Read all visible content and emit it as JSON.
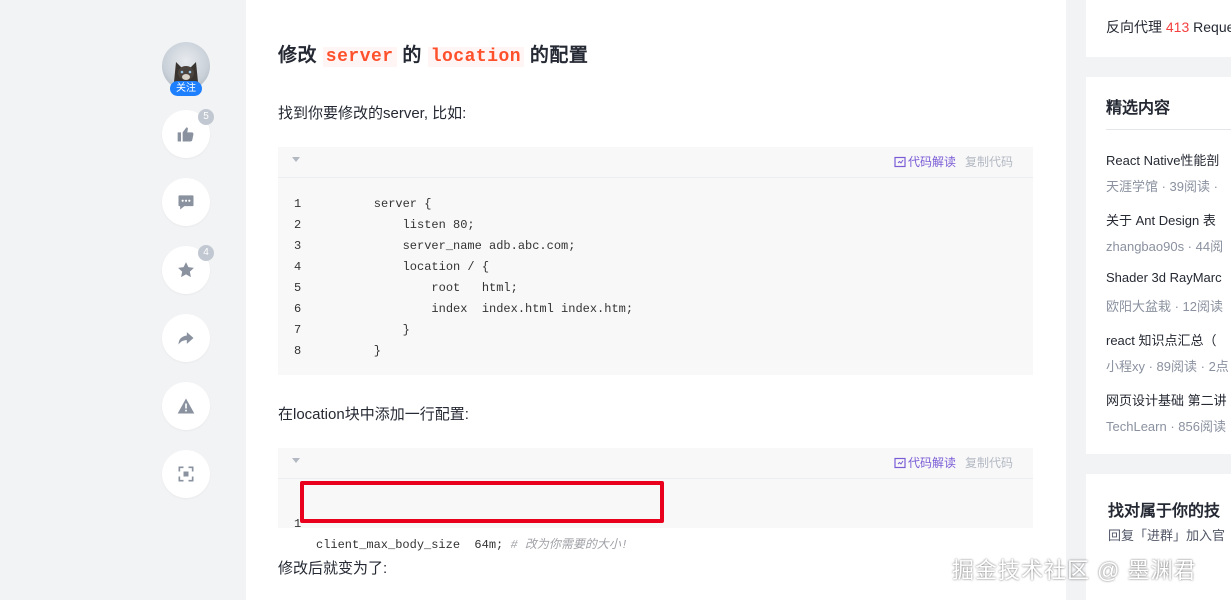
{
  "colors": {
    "accent": "#1e80ff",
    "inline_code": "#ff502c",
    "red_box": "#e8001c",
    "explain": "#7a5cd6"
  },
  "actions": {
    "follow_label": "关注",
    "like_count": "5",
    "collect_count": "4",
    "icons": [
      "thumbs-up-icon",
      "comment-icon",
      "star-icon",
      "share-icon",
      "warning-icon",
      "focus-mode-icon"
    ]
  },
  "article": {
    "heading": {
      "prefix": "修改",
      "code1": "server",
      "middle": "的",
      "code2": "location",
      "suffix": "的配置"
    },
    "para1": "找到你要修改的server, 比如:",
    "code1": {
      "explain_label": "代码解读",
      "copy_label": "复制代码",
      "lines": [
        {
          "n": "1",
          "text": "    server {"
        },
        {
          "n": "2",
          "text": "        listen 80;"
        },
        {
          "n": "3",
          "text": "        server_name adb.abc.com;"
        },
        {
          "n": "4",
          "text": "        location / {"
        },
        {
          "n": "5",
          "text": "            root   html;"
        },
        {
          "n": "6",
          "text": "            index  index.html index.htm;"
        },
        {
          "n": "7",
          "text": "        }"
        },
        {
          "n": "8",
          "text": "    }"
        }
      ]
    },
    "para2": "在location块中添加一行配置:",
    "code2": {
      "explain_label": "代码解读",
      "copy_label": "复制代码",
      "line_number": "1",
      "code": "client_max_body_size  64m; ",
      "comment": "# 改为你需要的大小!"
    },
    "para3": "修改后就变为了:"
  },
  "sidebar": {
    "top_text": {
      "prefix": "反向代理 ",
      "highlight": "413",
      "suffix": " Reque"
    },
    "featured_title": "精选内容",
    "featured": [
      {
        "title": "React Native性能剖",
        "meta": "天涯学馆 · 39阅读 ·"
      },
      {
        "title": "关于 Ant Design 表",
        "meta": "zhangbao90s · 44阅"
      },
      {
        "title": "Shader 3d RayMarc",
        "meta": "欧阳大盆栽 · 12阅读"
      },
      {
        "title": "react 知识点汇总（",
        "meta": "小程xy · 89阅读 · 2点"
      },
      {
        "title": "网页设计基础 第二讲",
        "meta": "TechLearn · 856阅读"
      }
    ],
    "promo_title": "找对属于你的技",
    "promo_text": "回复「进群」加入官"
  },
  "watermark": "掘金技术社区 @ 墨渊君"
}
